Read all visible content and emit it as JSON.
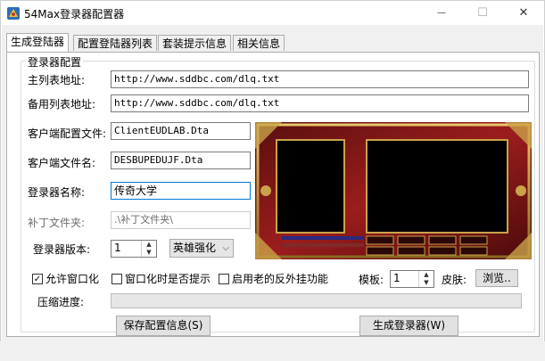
{
  "window": {
    "title": "54Max登录器配置器",
    "minimize_glyph": "—",
    "maximize_glyph": "☐",
    "close_glyph": "✕"
  },
  "tabs": [
    {
      "label": "生成登陆器",
      "active": true
    },
    {
      "label": "配置登陆器列表",
      "active": false
    },
    {
      "label": "套装提示信息",
      "active": false
    },
    {
      "label": "相关信息",
      "active": false
    }
  ],
  "group": {
    "title": "登录器配置"
  },
  "fields": {
    "main_list_label": "主列表地址:",
    "main_list_value": "http://www.sddbc.com/dlq.txt",
    "backup_list_label": "备用列表地址:",
    "backup_list_value": "http://www.sddbc.com/dlq.txt",
    "client_config_label": "客户端配置文件:",
    "client_config_value": "ClientEUDLAB.Dta",
    "client_file_label": "客户端文件名:",
    "client_file_value": "DESBUPEDUJF.Dta",
    "launcher_name_label": "登录器名称:",
    "launcher_name_value": "传奇大学",
    "patch_folder_label": "补丁文件夹:",
    "patch_folder_value": ".\\补丁文件夹\\",
    "version_label": "登录器版本:",
    "version_value": "1",
    "version_combo": "英雄强化"
  },
  "options": {
    "allow_window_label": "允许窗口化",
    "allow_window_checked": true,
    "window_prompt_label": "窗口化时是否提示",
    "window_prompt_checked": false,
    "old_anticheat_label": "启用老的反外挂功能",
    "old_anticheat_checked": false,
    "template_label": "模板:",
    "template_value": "1",
    "skin_label": "皮肤:",
    "browse_label": "浏览.."
  },
  "progress": {
    "label": "压缩进度:",
    "value": 0
  },
  "buttons": {
    "save_label": "保存配置信息(S)",
    "generate_label": "生成登录器(W)"
  },
  "colors": {
    "accent": "#0078d7",
    "skin_red": "#8b1a1a",
    "skin_gold": "#c9a24a",
    "skin_panel": "#000000"
  }
}
